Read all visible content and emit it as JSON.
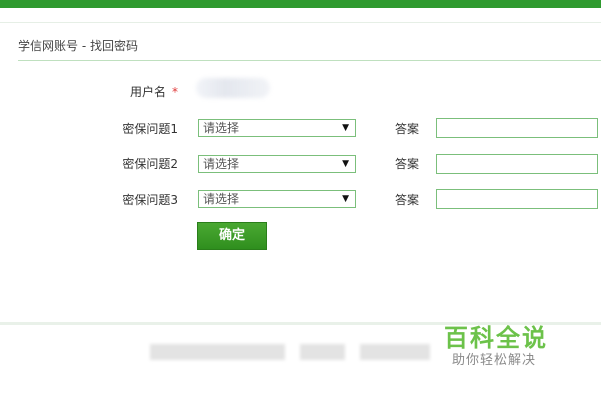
{
  "page": {
    "title": "学信网账号 - 找回密码"
  },
  "form": {
    "username_label": "用户名",
    "required_mark": "*",
    "questions": [
      {
        "label": "密保问题1",
        "select_value": "请选择",
        "answer_label": "答案"
      },
      {
        "label": "密保问题2",
        "select_value": "请选择",
        "answer_label": "答案"
      },
      {
        "label": "密保问题3",
        "select_value": "请选择",
        "answer_label": "答案"
      }
    ],
    "dropdown_arrow": "▼",
    "submit_label": "确定"
  },
  "watermark": {
    "title": "百科全说",
    "subtitle": "助你轻松解决"
  },
  "colors": {
    "brand_green": "#2f9a2f",
    "border_green": "#7bbf7b",
    "button_green": "#3a9c28",
    "required_red": "#e03a3a"
  }
}
